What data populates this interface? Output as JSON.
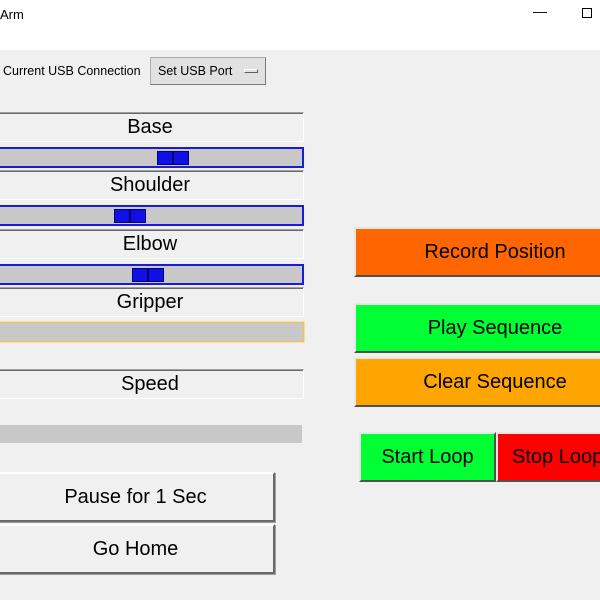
{
  "window": {
    "title": "Arm",
    "minimize_glyph": "—"
  },
  "usb": {
    "label": "Current USB Connection",
    "button_label": "Set USB Port"
  },
  "joints": [
    {
      "label": "Base",
      "value": 0.575
    },
    {
      "label": "Shoulder",
      "value": 0.435
    },
    {
      "label": "Elbow",
      "value": 0.495
    },
    {
      "label": "Gripper",
      "value": null
    }
  ],
  "speed": {
    "label": "Speed"
  },
  "buttons": {
    "pause": "Pause for 1 Sec",
    "home": "Go Home",
    "record": "Record Position",
    "play": "Play Sequence",
    "clear": "Clear Sequence",
    "start_loop": "Start Loop",
    "stop_loop": "Stop Loop"
  },
  "colors": {
    "record": "#ff6600",
    "play": "#00ff33",
    "clear": "#ffa500",
    "start_loop": "#00ff33",
    "stop_loop": "#ff0000",
    "slider_accent": "#1010e6"
  }
}
